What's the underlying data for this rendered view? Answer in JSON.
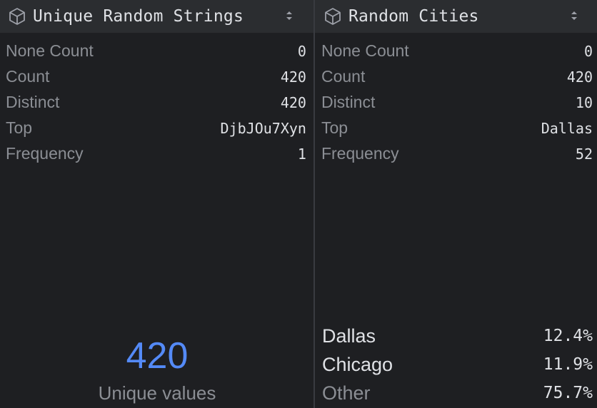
{
  "colors": {
    "background": "#1e1f22",
    "header_background": "#2b2d30",
    "text_primary": "#dfe1e5",
    "text_secondary": "#8b8e94",
    "accent": "#548af7"
  },
  "columns": [
    {
      "title": "Unique Random Strings",
      "icon": "cube-icon",
      "sort_icon": "sort-icon",
      "stats": [
        {
          "label": "None Count",
          "value": "0"
        },
        {
          "label": "Count",
          "value": "420"
        },
        {
          "label": "Distinct",
          "value": "420"
        },
        {
          "label": "Top",
          "value": "DjbJOu7Xyn"
        },
        {
          "label": "Frequency",
          "value": "1"
        }
      ],
      "summary": {
        "number": "420",
        "label": "Unique values"
      }
    },
    {
      "title": "Random Cities",
      "icon": "cube-icon",
      "sort_icon": "sort-icon",
      "stats": [
        {
          "label": "None Count",
          "value": "0"
        },
        {
          "label": "Count",
          "value": "420"
        },
        {
          "label": "Distinct",
          "value": "10"
        },
        {
          "label": "Top",
          "value": "Dallas"
        },
        {
          "label": "Frequency",
          "value": "52"
        }
      ],
      "frequencies": [
        {
          "label": "Dallas",
          "percent": "12.4%"
        },
        {
          "label": "Chicago",
          "percent": "11.9%"
        },
        {
          "label": "Other",
          "percent": "75.7%"
        }
      ]
    }
  ]
}
